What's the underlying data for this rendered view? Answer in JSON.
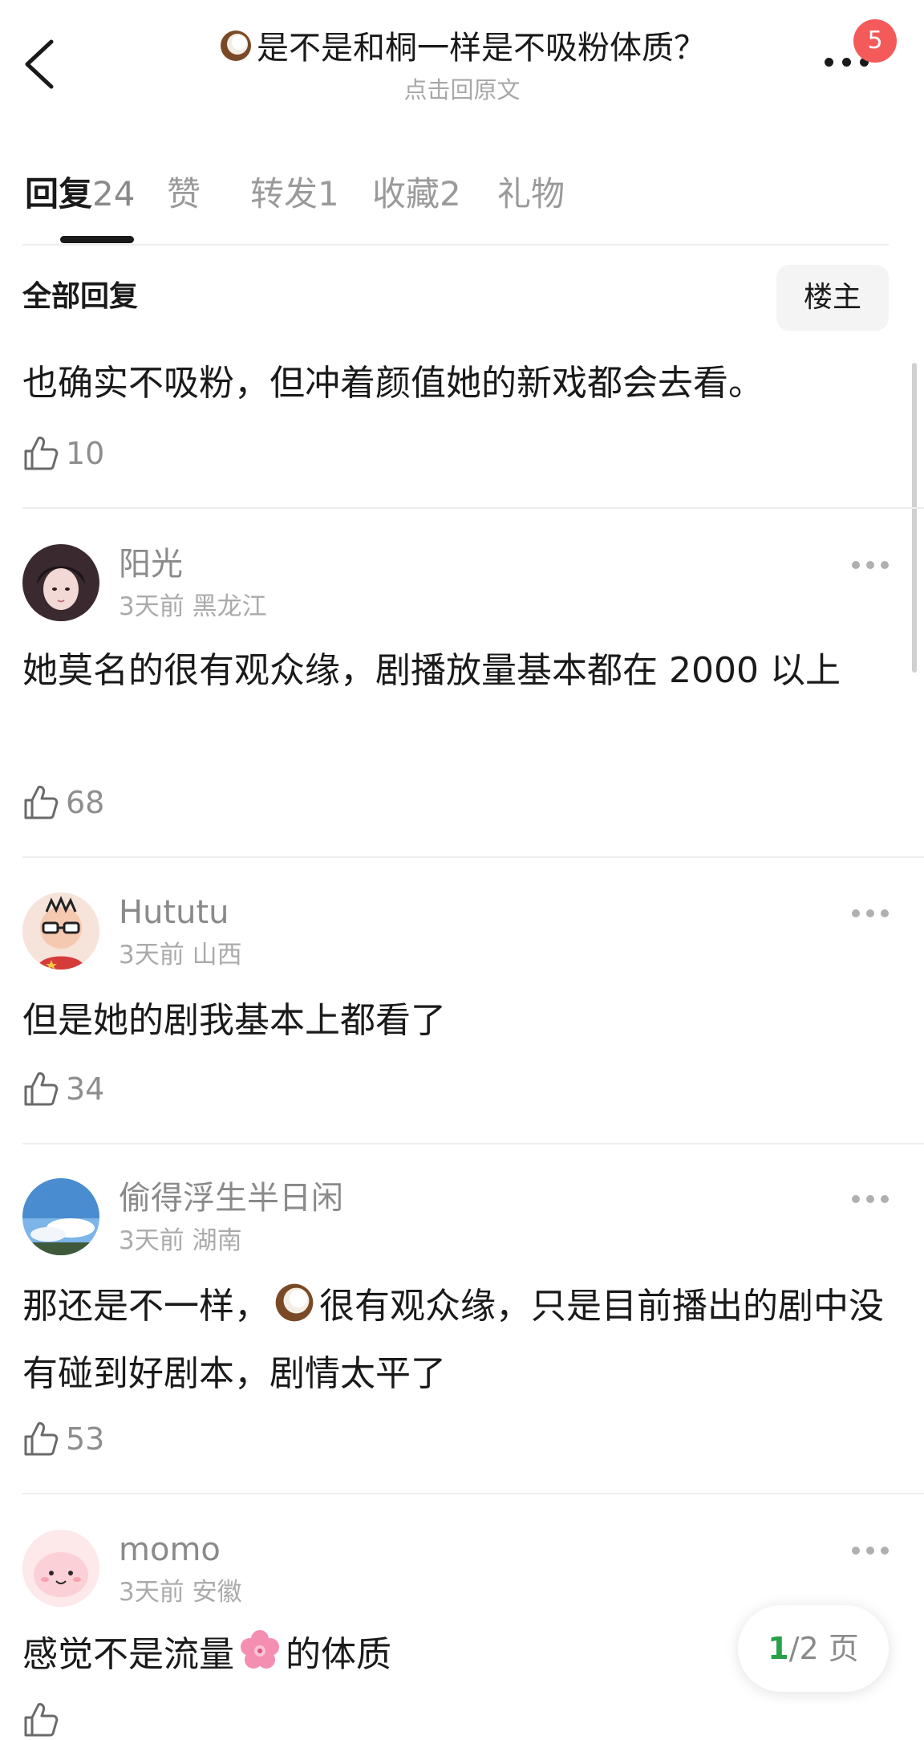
{
  "header": {
    "title": "是不是和桐一样是不吸粉体质？",
    "subtitle": "点击回原文",
    "badge_count": "5",
    "title_emoji": "coconut-icon"
  },
  "tabs": [
    {
      "name": "回复",
      "count": "24",
      "active": true
    },
    {
      "name": "赞",
      "count": "",
      "active": false
    },
    {
      "name": "转发",
      "count": "1",
      "active": false
    },
    {
      "name": "收藏",
      "count": "2",
      "active": false
    },
    {
      "name": "礼物",
      "count": "",
      "active": false
    }
  ],
  "filter": {
    "title": "全部回复",
    "owner_label": "楼主"
  },
  "comments": [
    {
      "text": "也确实不吸粉，但冲着颜值她的新戏都会去看。",
      "likes": "10"
    },
    {
      "user": "阳光",
      "time": "3天前",
      "location": "黑龙江",
      "text": "她莫名的很有观众缘，剧播放量基本都在 2000 以上",
      "likes": "68"
    },
    {
      "user": "Hututu",
      "time": "3天前",
      "location": "山西",
      "text": "但是她的剧我基本上都看了",
      "likes": "34"
    },
    {
      "user": "偷得浮生半日闲",
      "time": "3天前",
      "location": "湖南",
      "text_before": "那还是不一样，",
      "text_after": "很有观众缘，只是目前播出的剧中没有碰到好剧本，剧情太平了",
      "likes": "53"
    },
    {
      "user": "momo",
      "time": "3天前",
      "location": "安徽",
      "text_before": "感觉不是流量",
      "text_after": "的体质"
    }
  ],
  "pager": {
    "current": "1",
    "total": "/2 页"
  },
  "colors": {
    "badge": "#f55a5a",
    "pager_current": "#2aa04a",
    "muted": "#8a8a8a"
  }
}
